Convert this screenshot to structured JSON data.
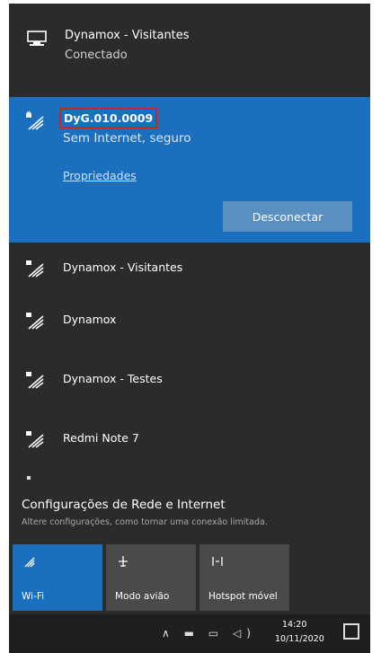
{
  "wired": {
    "name": "Dynamox - Visitantes",
    "status": "Conectado",
    "icon": "network-monitor-icon"
  },
  "selected": {
    "ssid": "DyG.010.0009",
    "status": "Sem Internet, seguro",
    "properties_label": "Propriedades",
    "disconnect_label": "Desconectar",
    "icon": "wifi-secured-icon"
  },
  "networks": [
    {
      "name": "Dynamox - Visitantes",
      "icon": "wifi-secured-icon"
    },
    {
      "name": "Dynamox",
      "icon": "wifi-secured-icon"
    },
    {
      "name": "Dynamox - Testes",
      "icon": "wifi-secured-icon"
    },
    {
      "name": "Redmi Note 7",
      "icon": "wifi-secured-icon"
    }
  ],
  "settings": {
    "title": "Configurações de Rede e Internet",
    "subtitle": "Altere configurações, como tornar uma conexão limitada."
  },
  "quick_actions": [
    {
      "label": "Wi-Fi",
      "icon": "wifi-icon",
      "active": true
    },
    {
      "label": "Modo avião",
      "icon": "airplane-icon",
      "active": false
    },
    {
      "label": "Hotspot móvel",
      "icon": "hotspot-icon",
      "active": false
    }
  ],
  "taskbar": {
    "time": "14:20",
    "date": "10/11/2020"
  },
  "colors": {
    "accent": "#1a6fbf",
    "panel": "#2b2b2b",
    "highlight_border": "#d32020"
  }
}
